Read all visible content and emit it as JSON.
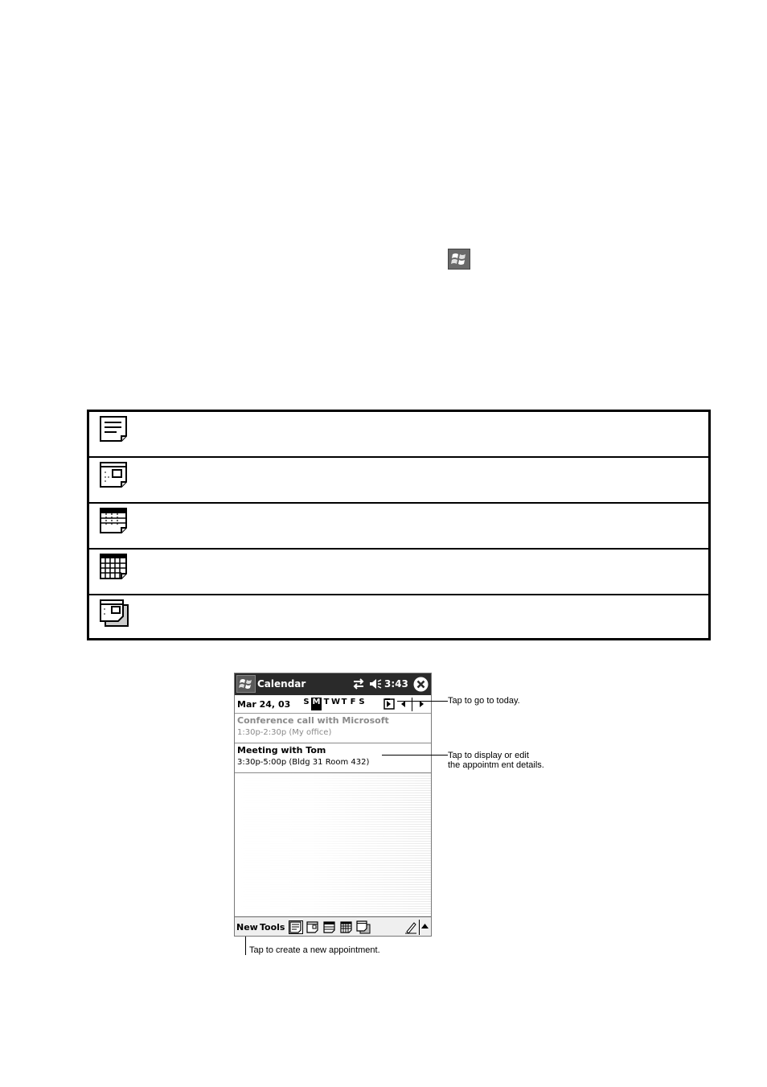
{
  "view_icons": [
    {
      "icon": "agenda-view-icon"
    },
    {
      "icon": "day-view-icon"
    },
    {
      "icon": "week-view-icon"
    },
    {
      "icon": "month-view-icon"
    },
    {
      "icon": "year-view-icon"
    }
  ],
  "pda": {
    "title": "Calendar",
    "clock": "3:43",
    "date": "Mar 24, 03",
    "weekdays": [
      "S",
      "M",
      "T",
      "W",
      "T",
      "F",
      "S"
    ],
    "selected_day_index": 1,
    "appointments": [
      {
        "title": "Conference call with Microsoft",
        "details": "1:30p-2:30p  (My office)",
        "past": true
      },
      {
        "title": "Meeting with Tom",
        "details": "3:30p-5:00p  (Bldg 31 Room 432)",
        "past": false
      }
    ],
    "menu": {
      "new": "New",
      "tools": "Tools"
    }
  },
  "callouts": {
    "today": "Tap to go to today.",
    "details_line1": "Tap to display or edit",
    "details_line2": "the appointm ent details.",
    "new_appt": "Tap to create a new appointment."
  },
  "colors": {
    "titlebar": "#2a2a2a",
    "past_text": "#8a8a8a"
  }
}
